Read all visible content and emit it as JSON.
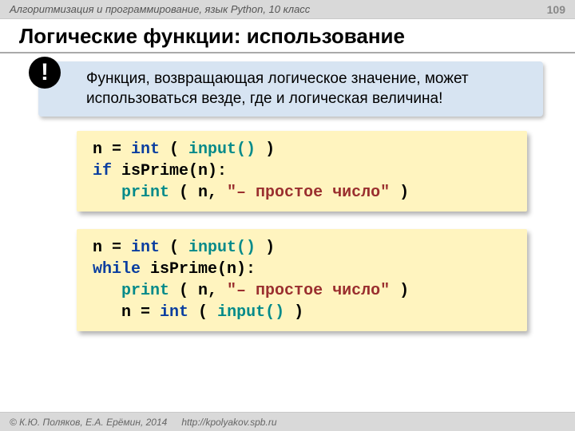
{
  "header": {
    "course": "Алгоритмизация и программирование, язык Python, 10 класс",
    "page": "109"
  },
  "title": "Логические функции: использование",
  "note": {
    "bang": "!",
    "text": "Функция, возвращающая логическое значение, может использоваться везде, где и логическая величина!"
  },
  "code1": {
    "l1a": "n = ",
    "l1_int": "int",
    "l1b": " ( ",
    "l1_input": "input()",
    "l1c": " )",
    "l2_if": "if",
    "l2b": " isPrime(n):",
    "l3_pad": "   ",
    "l3_print": "print",
    "l3b": " ( n, ",
    "l3_str": "\"– простое число\"",
    "l3c": " )"
  },
  "code2": {
    "l1a": "n = ",
    "l1_int": "int",
    "l1b": " ( ",
    "l1_input": "input()",
    "l1c": " )",
    "l2_while": "while",
    "l2b": " isPrime(n):",
    "l3_pad": "   ",
    "l3_print": "print",
    "l3b": " ( n, ",
    "l3_str": "\"– простое число\"",
    "l3c": " )",
    "l4_pad": "   ",
    "l4a": "n = ",
    "l4_int": "int",
    "l4b": " ( ",
    "l4_input": "input()",
    "l4c": " )"
  },
  "footer": {
    "copyright": "© К.Ю. Поляков, Е.А. Ерёмин, 2014",
    "url": "http://kpolyakov.spb.ru"
  }
}
